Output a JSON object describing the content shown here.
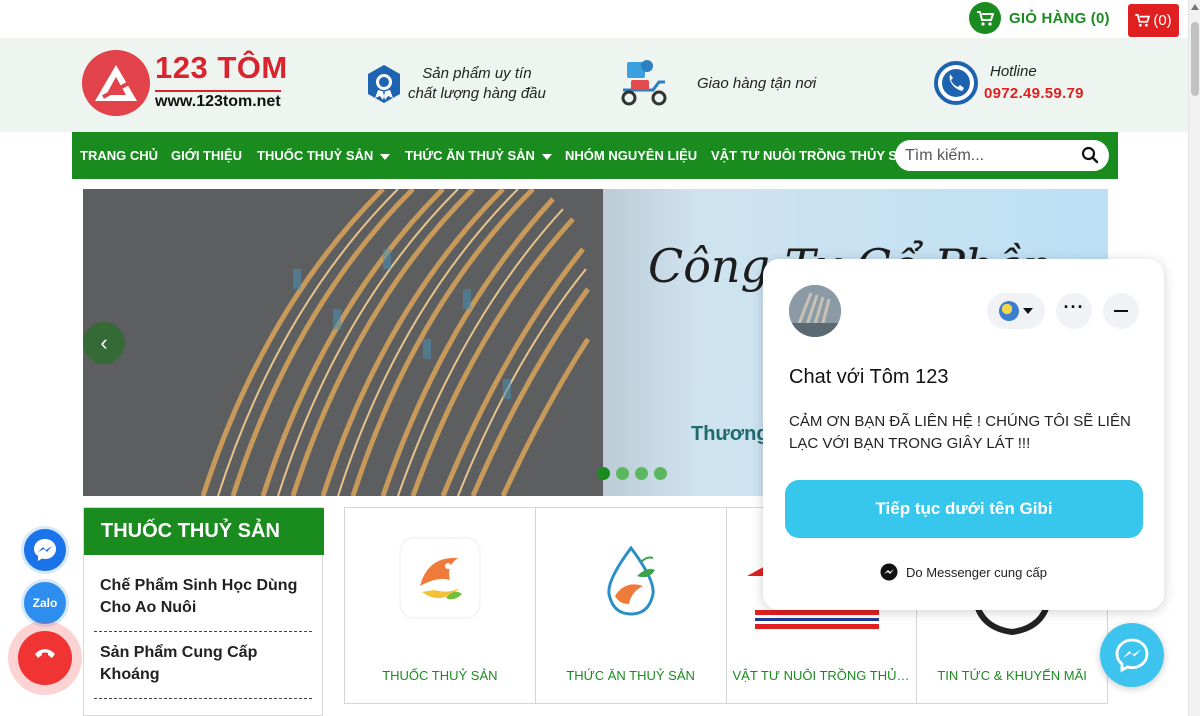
{
  "topbar": {
    "cart_label": "GIỎ HÀNG (0)",
    "cart_count": "(0)"
  },
  "brand": {
    "name": "123 TÔM",
    "url": "www.123tom.net"
  },
  "features": [
    {
      "line1": "Sản phẩm uy tín",
      "line2": "chất lượng hàng đầu",
      "icon": "quality-badge-icon"
    },
    {
      "line1": "Giao hàng tận nơi",
      "icon": "delivery-scooter-icon"
    }
  ],
  "hotline": {
    "title": "Hotline",
    "number": "0972.49.59.79",
    "icon": "phone-icon"
  },
  "nav": {
    "items": [
      {
        "label": "TRANG CHỦ"
      },
      {
        "label": "GIỚI THIỆU"
      },
      {
        "label": "THUỐC THUỶ SẢN"
      },
      {
        "label": "THỨC ĂN THUỶ SẢN"
      },
      {
        "label": "NHÓM NGUYÊN LIỆU"
      },
      {
        "label": "VẬT TƯ NUÔI TRỒNG THỦY SẢN"
      }
    ],
    "search_placeholder": "Tìm kiếm..."
  },
  "banner": {
    "text1": "Công Ty Cổ Phần",
    "text2": "Thương",
    "active_slide": 1,
    "slides": 4
  },
  "sidebar": {
    "title": "THUỐC THUỶ SẢN",
    "items": [
      {
        "label": "Chế Phẩm Sinh Học Dùng Cho Ao Nuôi"
      },
      {
        "label": "Sản Phẩm Cung Cấp Khoáng"
      }
    ]
  },
  "categories": [
    {
      "label": "THUỐC THUỶ SẢN"
    },
    {
      "label": "THỨC ĂN THUỶ SẢN"
    },
    {
      "label": "VẬT TƯ NUÔI TRỒNG THỦY SẢN"
    },
    {
      "label": "TIN TỨC & KHUYẾN MÃI"
    }
  ],
  "chat": {
    "title": "Chat với Tôm 123",
    "message": "CẢM ƠN BẠN ĐÃ LIÊN HỆ ! CHÚNG TÔI SẼ LIÊN LẠC VỚI BẠN TRONG GIÂY LÁT !!!",
    "cta": "Tiếp tục dưới tên Gibi",
    "footer": "Do Messenger cung cấp"
  },
  "fabs": {
    "zalo": "Zalo"
  },
  "colors": {
    "green": "#1a8c1f",
    "red": "#e02020",
    "chat_cta": "#37c6ec"
  }
}
